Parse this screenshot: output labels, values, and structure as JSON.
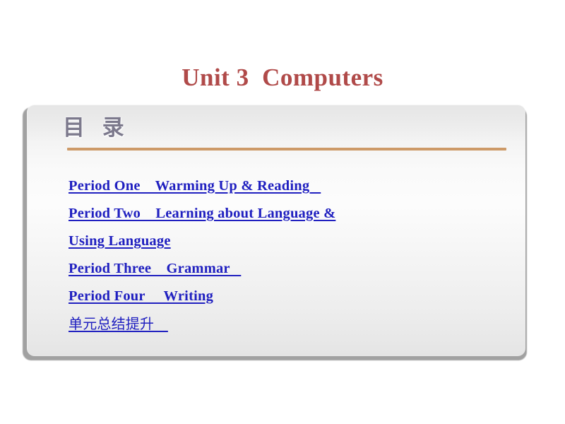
{
  "slide": {
    "title": "Unit 3  Computers",
    "title_color": "#b04a49",
    "background_color": "#ffffff"
  },
  "panel": {
    "header_label": "目 录",
    "header_color": "#7c798c",
    "rule_color": "#cd9a68",
    "background_top_color": "#e6e6e6",
    "background_mid_color": "#fcfcfc",
    "background_bottom_color": "#e4e4e4",
    "shadow_color": "#9d9d9d"
  },
  "toc": {
    "link_color": "#2020c0",
    "lines": [
      {
        "text": "Period One    Warming Up & Reading   ",
        "script": "latin"
      },
      {
        "text": "Period Two    Learning about Language &",
        "script": "latin"
      },
      {
        "text": "Using Language",
        "script": "latin"
      },
      {
        "text": "Period Three    Grammar   ",
        "script": "latin"
      },
      {
        "text": "Period Four     Writing",
        "script": "latin"
      },
      {
        "text": "单元总结提升   ",
        "script": "cjk"
      }
    ]
  }
}
